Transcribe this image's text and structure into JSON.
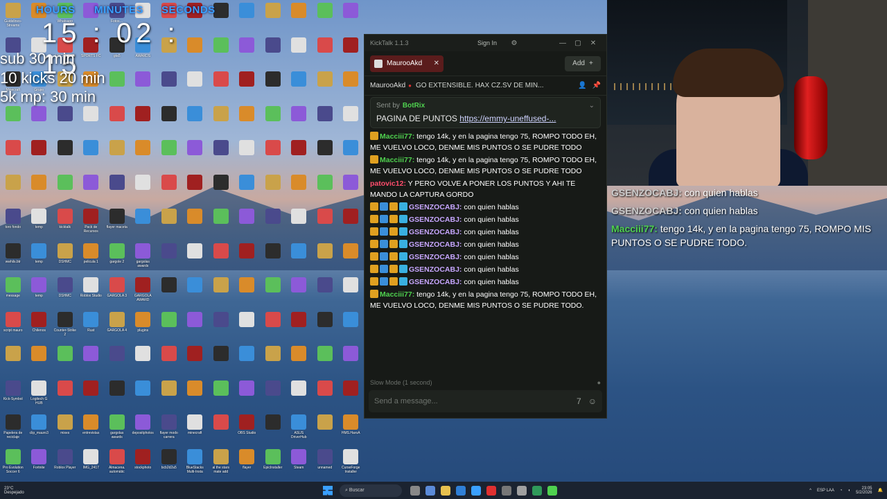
{
  "timer": {
    "hours_label": "HOURS",
    "minutes_label": "MINUTES",
    "seconds_label": "SECONDS",
    "time": "15 : 02 : 15",
    "rules": [
      "sub 30 min",
      "10 kicks 20 min",
      "5k mp: 30 min"
    ]
  },
  "desktop_icons": [
    "Guidelines-Streams",
    "",
    "Whatsapp",
    "",
    "Fotos…",
    "",
    "",
    "",
    "",
    "",
    "",
    "",
    "",
    "",
    "",
    "",
    "EPIC Games",
    "SPORTS FC",
    "gta5",
    "AWARDS",
    "",
    "",
    "",
    "",
    "",
    "",
    "",
    "",
    "Minecraft",
    "Grupo",
    "",
    "",
    "",
    "",
    "",
    "",
    "",
    "",
    "",
    "",
    "",
    "",
    "",
    "",
    "",
    "",
    "",
    "",
    "",
    "",
    "",
    "",
    "",
    "",
    "",
    "",
    "",
    "",
    "",
    "",
    "",
    "",
    "",
    "",
    "",
    "",
    "",
    "",
    "",
    "",
    "",
    "",
    "",
    "",
    "",
    "",
    "",
    "",
    "",
    "",
    "",
    "",
    "",
    "",
    "toro fondo",
    "temp",
    "kicktalk",
    "Pack de Recursos",
    "flayer maceta",
    "",
    "",
    "",
    "",
    "",
    "",
    "",
    "",
    "",
    "wwhils.btr",
    "temp",
    "DSHMC",
    "pelicula 1",
    "gargole 2",
    "gargolas awards",
    "",
    "",
    "",
    "",
    "",
    "",
    "",
    "",
    "message",
    "temp",
    "DSHMC",
    "Roblox Studio",
    "GARGOLA 3",
    "GARGOLA AWARD",
    "",
    "",
    "",
    "",
    "",
    "",
    "",
    "",
    "script mauro",
    "Chilenos",
    "Counter-Strike 2",
    "Rust",
    "GARGOLA 4",
    "plugins",
    "",
    "",
    "",
    "",
    "",
    "",
    "",
    "",
    "",
    "",
    "",
    "",
    "",
    "",
    "",
    "",
    "",
    "",
    "",
    "",
    "",
    "",
    "Kick-Symbol",
    "Logitech G HUB",
    "",
    "",
    "",
    "",
    "",
    "",
    "",
    "",
    "",
    "",
    "",
    "",
    "Papelera de reciclaje",
    "clip_mauro3",
    "mixes",
    "entrevistas",
    "gargolas awards",
    "depositphotos",
    "flayer modo carrera",
    "minecraft",
    "",
    "OBS Studio",
    "",
    "ASUS DriverHub",
    "",
    "HMS.HaroA",
    "Pro Evolution Soccer 6",
    "Fortnite",
    "Roblox Player",
    "IMG_2417",
    "Almacena. automátic",
    "stockphoto",
    "bcb2d2a5",
    "BlueStacks Multi-Insta",
    "al the stars mate add",
    "flayer",
    "EpicInstaller",
    "Steam",
    "unnamed",
    "CurseForge Installer"
  ],
  "kicktalk": {
    "title": "KickTalk 1.1.3",
    "sign_in": "Sign In",
    "tab_name": "MaurooAkd",
    "add_label": "Add",
    "channel": "MaurooAkd",
    "topic": "GO EXTENSIBLE. HAX CZ.SV DE MIN...",
    "pinned": {
      "sent_by": "Sent by",
      "bot_name": "BotRix",
      "text": "PAGINA DE PUNTOS",
      "link": "https://emmy-uneffused-..."
    },
    "messages": [
      {
        "user": "Macciii77:",
        "text": "tengo 14k, y en la pagina tengo 75, ROMPO TODO EH, ME VUELVO LOCO, DENME MIS PUNTOS O SE PUDRE TODO",
        "color": "#4fd14f"
      },
      {
        "user": "Macciii77:",
        "text": "tengo 14k, y en la pagina tengo 75, ROMPO TODO EH, ME VUELVO LOCO, DENME MIS PUNTOS O SE PUDRE TODO",
        "color": "#4fd14f"
      },
      {
        "user": "patovic12:",
        "text": "Y PERO VOLVE A PONER LOS PUNTOS Y AHI TE MANDO LA CAPTURA GORDO",
        "color": "#ff4d6d"
      },
      {
        "user": "GSENZOCABJ:",
        "text": "con quien hablas",
        "color": "#c7a6ff"
      },
      {
        "user": "GSENZOCABJ:",
        "text": "con quien hablas",
        "color": "#c7a6ff"
      },
      {
        "user": "GSENZOCABJ:",
        "text": "con quien hablas",
        "color": "#c7a6ff"
      },
      {
        "user": "GSENZOCABJ:",
        "text": "con quien hablas",
        "color": "#c7a6ff"
      },
      {
        "user": "GSENZOCABJ:",
        "text": "con quien hablas",
        "color": "#c7a6ff"
      },
      {
        "user": "GSENZOCABJ:",
        "text": "con quien hablas",
        "color": "#c7a6ff"
      },
      {
        "user": "GSENZOCABJ:",
        "text": "con quien hablas",
        "color": "#c7a6ff"
      },
      {
        "user": "Macciii77:",
        "text": "tengo 14k, y en la pagina tengo 75, ROMPO TODO EH, ME VUELVO LOCO, DENME MIS PUNTOS O SE PUDRE TODO.",
        "color": "#4fd14f"
      }
    ],
    "slow_mode": "Slow Mode (1 second)",
    "placeholder": "Send a message..."
  },
  "mirror": [
    {
      "user": "GSENZOCABJ:",
      "text": "con quien hablas"
    },
    {
      "user": "GSENZOCABJ:",
      "text": "con quien hablas"
    },
    {
      "user": "Macciii77:",
      "text": "tengo 14k, y en la pagina tengo 75, ROMPO MIS PUNTOS O SE PUDRE TODO."
    }
  ],
  "taskbar": {
    "weather_temp": "23°C",
    "weather_desc": "Despejado",
    "search": "Buscar",
    "lang": "ESP LAA",
    "time": "23:05",
    "date": "5/2/2026"
  }
}
